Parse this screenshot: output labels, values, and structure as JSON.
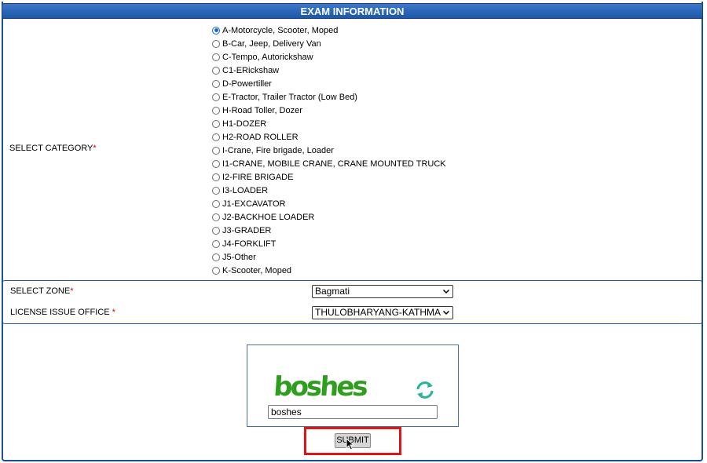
{
  "header": {
    "title": "EXAM INFORMATION"
  },
  "category": {
    "label": "SELECT CATEGORY",
    "required_mark": "*",
    "options": [
      {
        "label": "A-Motorcycle, Scooter, Moped",
        "checked": true
      },
      {
        "label": "B-Car, Jeep, Delivery Van",
        "checked": false
      },
      {
        "label": "C-Tempo, Autorickshaw",
        "checked": false
      },
      {
        "label": "C1-ERickshaw",
        "checked": false
      },
      {
        "label": "D-Powertiller",
        "checked": false
      },
      {
        "label": "E-Tractor, Trailer Tractor (Low Bed)",
        "checked": false
      },
      {
        "label": "H-Road Toller, Dozer",
        "checked": false
      },
      {
        "label": "H1-DOZER",
        "checked": false
      },
      {
        "label": "H2-ROAD ROLLER",
        "checked": false
      },
      {
        "label": "I-Crane, Fire brigade, Loader",
        "checked": false
      },
      {
        "label": "I1-CRANE, MOBILE CRANE, CRANE MOUNTED TRUCK",
        "checked": false
      },
      {
        "label": "I2-FIRE BRIGADE",
        "checked": false
      },
      {
        "label": "I3-LOADER",
        "checked": false
      },
      {
        "label": "J1-EXCAVATOR",
        "checked": false
      },
      {
        "label": "J2-BACKHOE LOADER",
        "checked": false
      },
      {
        "label": "J3-GRADER",
        "checked": false
      },
      {
        "label": "J4-FORKLIFT",
        "checked": false
      },
      {
        "label": "J5-Other",
        "checked": false
      },
      {
        "label": "K-Scooter, Moped",
        "checked": false
      }
    ]
  },
  "zone": {
    "label": "SELECT ZONE",
    "required_mark": "*",
    "selected": "Bagmati"
  },
  "office": {
    "label": "LICENSE ISSUE OFFICE ",
    "required_mark": "*",
    "selected": "THULOBHARYANG-KATHMA"
  },
  "captcha": {
    "image_text": "boshes",
    "input_value": "boshes"
  },
  "submit": {
    "label": "SUBMIT"
  },
  "colors": {
    "header": "#1d57a8",
    "required": "#d40000",
    "highlight": "#e01616",
    "captcha_text": "#2f9e1e",
    "refresh_icon": "#2bb39a"
  }
}
